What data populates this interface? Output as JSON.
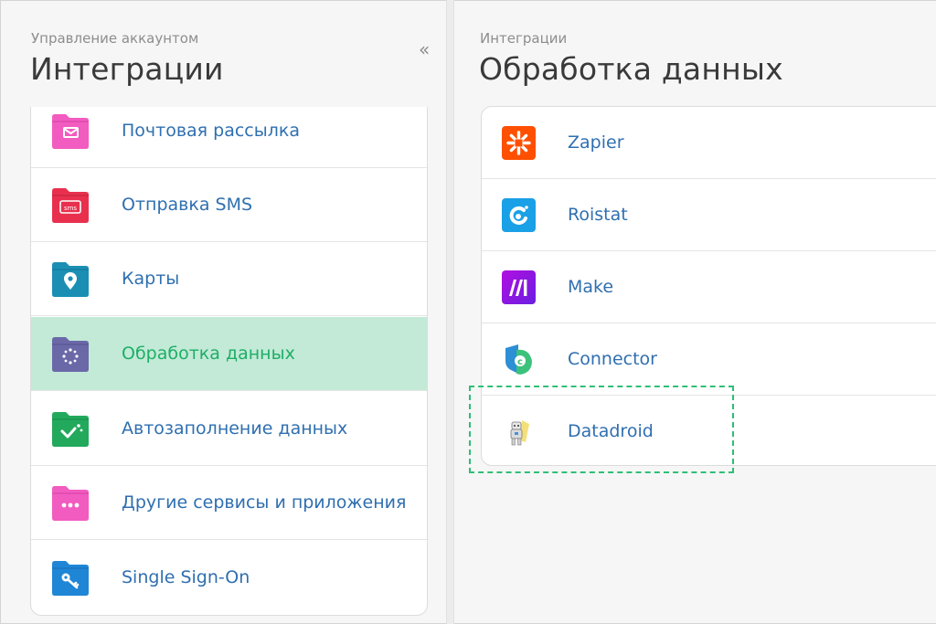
{
  "left": {
    "breadcrumb": "Управление аккаунтом",
    "title": "Интеграции",
    "collapse_glyph": "«",
    "items": [
      {
        "label": "Почтовая рассылка",
        "icon": "mail-folder-icon",
        "color": "#f25bbf"
      },
      {
        "label": "Отправка SMS",
        "icon": "sms-folder-icon",
        "color": "#e8304e"
      },
      {
        "label": "Карты",
        "icon": "map-pin-folder-icon",
        "color": "#1a8fb3"
      },
      {
        "label": "Обработка данных",
        "icon": "data-processing-folder-icon",
        "color": "#6b68a8",
        "active": true
      },
      {
        "label": "Автозаполнение данных",
        "icon": "autofill-folder-icon",
        "color": "#22a95c"
      },
      {
        "label": "Другие сервисы и приложения",
        "icon": "more-folder-icon",
        "color": "#f25bbf"
      },
      {
        "label": "Single Sign-On",
        "icon": "key-folder-icon",
        "color": "#1f86d6"
      }
    ]
  },
  "right": {
    "breadcrumb": "Интеграции",
    "title": "Обработка данных",
    "items": [
      {
        "label": "Zapier",
        "icon": "zapier-logo-icon",
        "color": "#ff4f00"
      },
      {
        "label": "Roistat",
        "icon": "roistat-logo-icon",
        "color": "#1aa0e6"
      },
      {
        "label": "Make",
        "icon": "make-logo-icon",
        "color": "#8e1ee0"
      },
      {
        "label": "Connector",
        "icon": "connector-logo-icon",
        "color": "#2d8fd5"
      },
      {
        "label": "Datadroid",
        "icon": "datadroid-logo-icon",
        "color": "#f0d23a"
      }
    ]
  },
  "colors": {
    "accent_green": "#1fae66",
    "active_row": "#c2ead7",
    "link_blue": "#2f6fb0"
  }
}
